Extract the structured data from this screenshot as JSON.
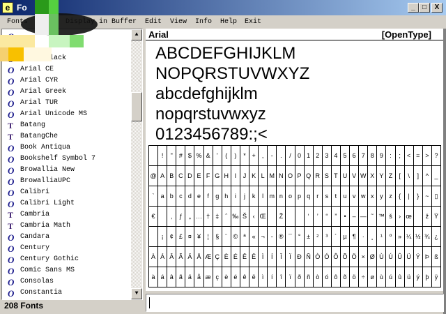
{
  "window": {
    "title": "Fo",
    "icon": "app-icon",
    "minimize": "_",
    "maximize": "□",
    "close": "X"
  },
  "menu": [
    {
      "label": "Fonts"
    },
    {
      "label": "Display in Buffer"
    },
    {
      "label": "Edit"
    },
    {
      "label": "View"
    },
    {
      "label": "Info"
    },
    {
      "label": "Help"
    },
    {
      "label": "Exit"
    }
  ],
  "fonts": [
    {
      "name": "",
      "type": "opentype"
    },
    {
      "name": "",
      "type": "opentype"
    },
    {
      "name": "Arial Black",
      "type": "opentype"
    },
    {
      "name": "Arial CE",
      "type": "opentype"
    },
    {
      "name": "Arial CYR",
      "type": "opentype"
    },
    {
      "name": "Arial Greek",
      "type": "opentype"
    },
    {
      "name": "Arial TUR",
      "type": "opentype"
    },
    {
      "name": "Arial Unicode MS",
      "type": "opentype"
    },
    {
      "name": "Batang",
      "type": "truetype"
    },
    {
      "name": "BatangChe",
      "type": "truetype"
    },
    {
      "name": "Book Antiqua",
      "type": "opentype"
    },
    {
      "name": "Bookshelf Symbol 7",
      "type": "opentype"
    },
    {
      "name": "Browallia New",
      "type": "opentype"
    },
    {
      "name": "BrowalliaUPC",
      "type": "opentype"
    },
    {
      "name": "Calibri",
      "type": "opentype"
    },
    {
      "name": "Calibri Light",
      "type": "opentype"
    },
    {
      "name": "Cambria",
      "type": "truetype"
    },
    {
      "name": "Cambria Math",
      "type": "truetype"
    },
    {
      "name": "Candara",
      "type": "opentype"
    },
    {
      "name": "Century",
      "type": "opentype"
    },
    {
      "name": "Century Gothic",
      "type": "opentype"
    },
    {
      "name": "Comic Sans MS",
      "type": "opentype"
    },
    {
      "name": "Consolas",
      "type": "opentype"
    },
    {
      "name": "Constantia",
      "type": "opentype"
    }
  ],
  "status": "208 Fonts",
  "preview": {
    "font": "Arial",
    "type": "[OpenType]",
    "samples": [
      "ABCDEFGHIJKLM",
      "NOPQRSTUVWXYZ",
      "abcdefghijklm",
      "nopqrstuvwxyz",
      "0123456789:;<"
    ],
    "grid": [
      [
        " ",
        "!",
        "\"",
        "#",
        "$",
        "%",
        "&",
        "'",
        "(",
        ")",
        "*",
        "+",
        ",",
        "-",
        ".",
        "/",
        "0",
        "1",
        "2",
        "3",
        "4",
        "5",
        "6",
        "7",
        "8",
        "9",
        ":",
        ";",
        "<",
        "=",
        ">",
        "?"
      ],
      [
        "@",
        "A",
        "B",
        "C",
        "D",
        "E",
        "F",
        "G",
        "H",
        "I",
        "J",
        "K",
        "L",
        "M",
        "N",
        "O",
        "P",
        "Q",
        "R",
        "S",
        "T",
        "U",
        "V",
        "W",
        "X",
        "Y",
        "Z",
        "[",
        "\\",
        "]",
        "^",
        "_"
      ],
      [
        "`",
        "a",
        "b",
        "c",
        "d",
        "e",
        "f",
        "g",
        "h",
        "i",
        "j",
        "k",
        "l",
        "m",
        "n",
        "o",
        "p",
        "q",
        "r",
        "s",
        "t",
        "u",
        "v",
        "w",
        "x",
        "y",
        "z",
        "{",
        "|",
        "}",
        "~",
        "▯"
      ],
      [
        "€",
        "",
        "‚",
        "ƒ",
        "„",
        "…",
        "†",
        "‡",
        "ˆ",
        "‰",
        "Š",
        "‹",
        "Œ",
        "",
        "Ž",
        "",
        "",
        "‘",
        "’",
        "“",
        "”",
        "•",
        "–",
        "—",
        "˜",
        "™",
        "š",
        "›",
        "œ",
        "",
        "ž",
        "Ÿ"
      ],
      [
        " ",
        "¡",
        "¢",
        "£",
        "¤",
        "¥",
        "¦",
        "§",
        "¨",
        "©",
        "ª",
        "«",
        "¬",
        "-",
        "®",
        "¯",
        "°",
        "±",
        "²",
        "³",
        "´",
        "µ",
        "¶",
        "·",
        "¸",
        "¹",
        "º",
        "»",
        "¼",
        "½",
        "¾",
        "¿"
      ],
      [
        "À",
        "Á",
        "Â",
        "Ã",
        "Ä",
        "Å",
        "Æ",
        "Ç",
        "È",
        "É",
        "Ê",
        "Ë",
        "Ì",
        "Í",
        "Î",
        "Ï",
        "Ð",
        "Ñ",
        "Ò",
        "Ó",
        "Ô",
        "Õ",
        "Ö",
        "×",
        "Ø",
        "Ù",
        "Ú",
        "Û",
        "Ü",
        "Ý",
        "Þ",
        "ß"
      ],
      [
        "à",
        "á",
        "â",
        "ã",
        "ä",
        "å",
        "æ",
        "ç",
        "è",
        "é",
        "ê",
        "ë",
        "ì",
        "í",
        "î",
        "ï",
        "ð",
        "ñ",
        "ò",
        "ó",
        "ô",
        "õ",
        "ö",
        "÷",
        "ø",
        "ù",
        "ú",
        "û",
        "ü",
        "ý",
        "þ",
        "ÿ"
      ]
    ]
  },
  "buffer": {
    "value": ""
  },
  "scrollbar": {
    "position": 0.25
  }
}
